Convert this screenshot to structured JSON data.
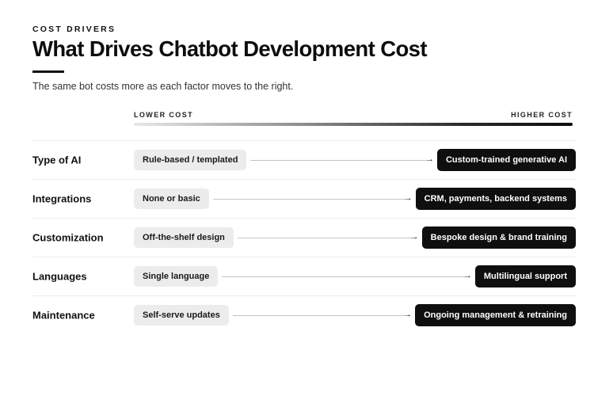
{
  "header": {
    "eyebrow": "COST DRIVERS",
    "title": "What Drives Chatbot Development Cost",
    "subtitle": "The same bot costs more as each factor moves to the right."
  },
  "scale": {
    "low_label": "LOWER COST",
    "high_label": "HIGHER COST"
  },
  "factors": [
    {
      "label": "Type of AI",
      "low": "Rule-based / templated",
      "high": "Custom-trained generative AI"
    },
    {
      "label": "Integrations",
      "low": "None or basic",
      "high": "CRM, payments, backend systems"
    },
    {
      "label": "Customization",
      "low": "Off-the-shelf design",
      "high": "Bespoke design & brand training"
    },
    {
      "label": "Languages",
      "low": "Single language",
      "high": "Multilingual support"
    },
    {
      "label": "Maintenance",
      "low": "Self-serve updates",
      "high": "Ongoing management & retraining"
    }
  ],
  "arrow_glyph": "→",
  "colors": {
    "text": "#111111",
    "low_pill_bg": "#ececec",
    "high_pill_bg": "#0f0f0f",
    "high_pill_text": "#ffffff"
  }
}
